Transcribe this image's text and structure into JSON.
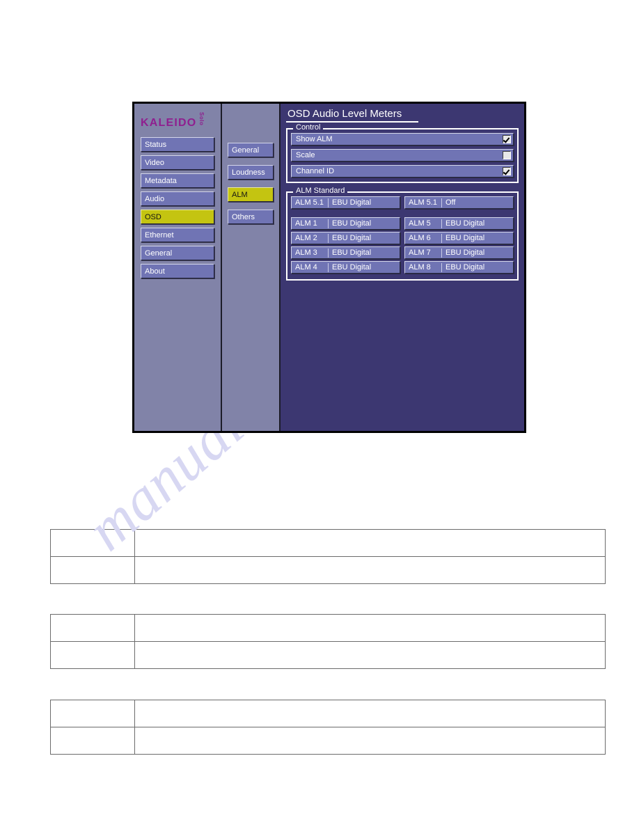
{
  "device_ui": {
    "logo": {
      "brand": "KALEIDO",
      "model": "Solo"
    },
    "left_nav": [
      {
        "label": "Status",
        "selected": false
      },
      {
        "label": "Video",
        "selected": false
      },
      {
        "label": "Metadata",
        "selected": false
      },
      {
        "label": "Audio",
        "selected": false
      },
      {
        "label": "OSD",
        "selected": true
      },
      {
        "label": "Ethernet",
        "selected": false
      },
      {
        "label": "General",
        "selected": false
      },
      {
        "label": "About",
        "selected": false
      }
    ],
    "sub_nav": [
      {
        "label": "General",
        "selected": false
      },
      {
        "label": "Loudness",
        "selected": false
      },
      {
        "label": "ALM",
        "selected": true
      },
      {
        "label": "Others",
        "selected": false
      }
    ],
    "page_title": "OSD Audio Level Meters",
    "control_group": {
      "legend": "Control",
      "rows": [
        {
          "label": "Show ALM",
          "checked": true
        },
        {
          "label": "Scale",
          "checked": false
        },
        {
          "label": "Channel ID",
          "checked": true
        }
      ]
    },
    "alm_standard_group": {
      "legend": "ALM Standard",
      "surround": [
        {
          "label": "ALM 5.1",
          "value": "EBU Digital"
        },
        {
          "label": "ALM 5.1",
          "value": "Off"
        }
      ],
      "left_column": [
        {
          "label": "ALM 1",
          "value": "EBU Digital"
        },
        {
          "label": "ALM 2",
          "value": "EBU Digital"
        },
        {
          "label": "ALM 3",
          "value": "EBU Digital"
        },
        {
          "label": "ALM 4",
          "value": "EBU Digital"
        }
      ],
      "right_column": [
        {
          "label": "ALM 5",
          "value": "EBU Digital"
        },
        {
          "label": "ALM 6",
          "value": "EBU Digital"
        },
        {
          "label": "ALM 7",
          "value": "EBU Digital"
        },
        {
          "label": "ALM 8",
          "value": "EBU Digital"
        }
      ]
    },
    "colors": {
      "panel_background": "#3c3771",
      "nav_background": "#8183a8",
      "button": "#7074b4",
      "selected_button": "#c4c411",
      "brand": "#8f1f8f",
      "text": "#ffffff"
    }
  },
  "watermark": {
    "text": "manualshive.com"
  },
  "document_tables": [
    {
      "rows": [
        {
          "c1": "",
          "c2": ""
        },
        {
          "c1": "",
          "c2": ""
        }
      ]
    },
    {
      "rows": [
        {
          "c1": "",
          "c2": ""
        },
        {
          "c1": "",
          "c2": ""
        }
      ]
    },
    {
      "rows": [
        {
          "c1": "",
          "c2": ""
        },
        {
          "c1": "",
          "c2": ""
        }
      ]
    }
  ]
}
